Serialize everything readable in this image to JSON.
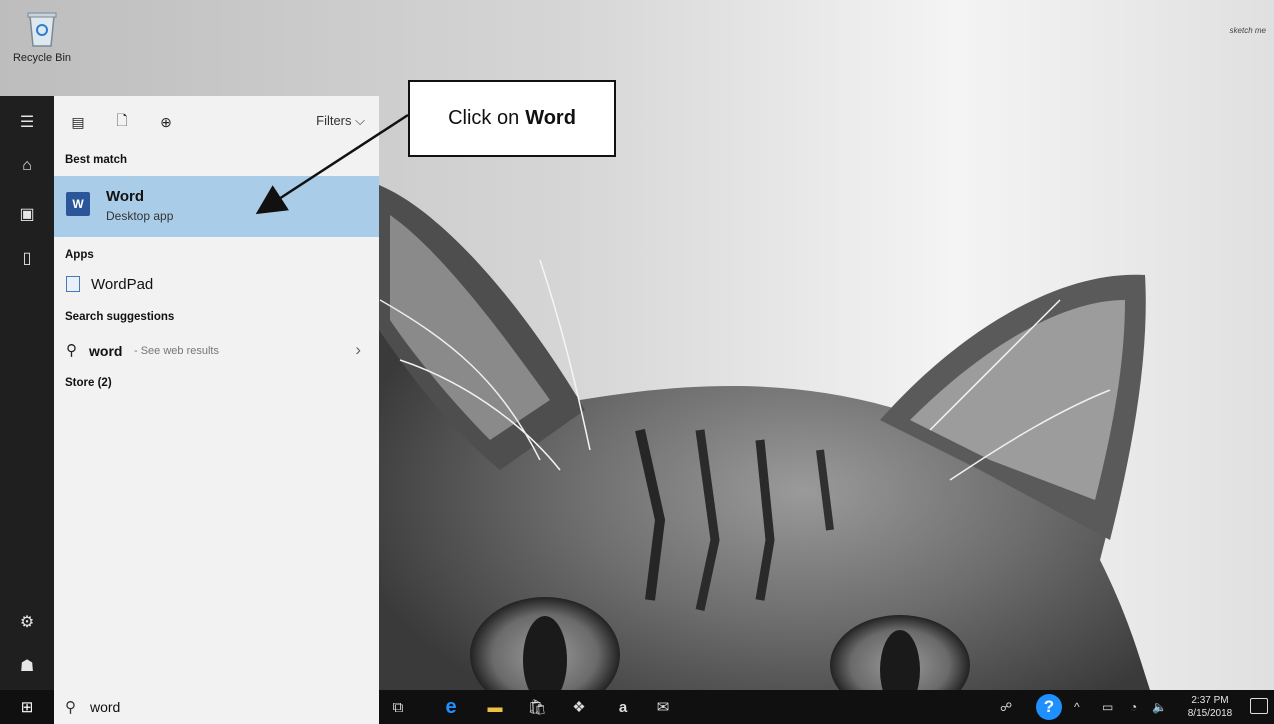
{
  "desktop": {
    "recycle_bin_label": "Recycle Bin",
    "corner_text": "sketch me"
  },
  "start_menu": {
    "filters_label": "Filters",
    "best_match_heading": "Best match",
    "best_match": {
      "title": "Word",
      "subtitle": "Desktop app",
      "logo_letter": "W"
    },
    "apps_heading": "Apps",
    "apps": [
      {
        "label": "WordPad"
      }
    ],
    "search_suggestions_heading": "Search suggestions",
    "suggestion": {
      "query": "word",
      "hint": "- See web results"
    },
    "store_heading": "Store (2)"
  },
  "callout": {
    "prefix": "Click on",
    "bold": "Word"
  },
  "taskbar": {
    "search_value": "word",
    "time": "2:37 PM",
    "date": "8/15/2018"
  },
  "colors": {
    "selection": "#a9cde8",
    "word_blue": "#2b579a",
    "help_blue": "#1e90ff"
  }
}
